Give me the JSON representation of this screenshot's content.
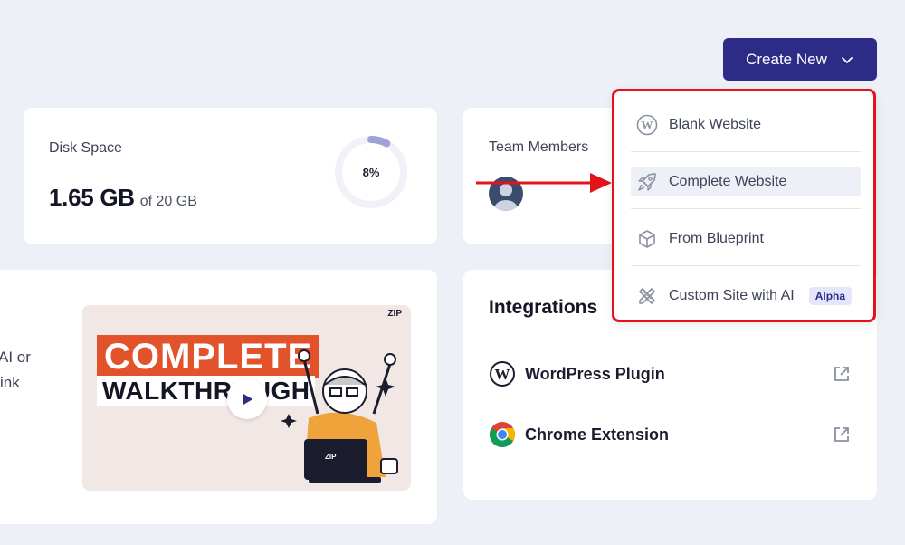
{
  "header": {
    "create_new_label": "Create New"
  },
  "disk": {
    "label": "Disk Space",
    "used": "1.65 GB",
    "of_total": "of 20 GB",
    "percent_label": "8%",
    "percent": 8
  },
  "team": {
    "label": "Team Members"
  },
  "promo": {
    "line1": "AI or",
    "line2": "ink"
  },
  "video": {
    "title_line1": "COMPLETE",
    "title_line2": "WALKTHROUGH",
    "brand": "ZIP"
  },
  "integrations": {
    "title": "Integrations",
    "items": [
      {
        "name": "WordPress Plugin",
        "icon": "wordpress-icon"
      },
      {
        "name": "Chrome Extension",
        "icon": "chrome-icon"
      }
    ]
  },
  "dropdown": {
    "items": [
      {
        "label": "Blank Website",
        "icon": "wordpress-icon"
      },
      {
        "label": "Complete Website",
        "icon": "rocket-icon"
      },
      {
        "label": "From Blueprint",
        "icon": "cube-icon"
      },
      {
        "label": "Custom Site with AI",
        "icon": "pencil-ruler-icon",
        "badge": "Alpha"
      }
    ]
  },
  "colors": {
    "primary": "#2c2c86",
    "annotation": "#e6121a",
    "ring": "#9ea3d6",
    "background": "#eef0f8"
  }
}
